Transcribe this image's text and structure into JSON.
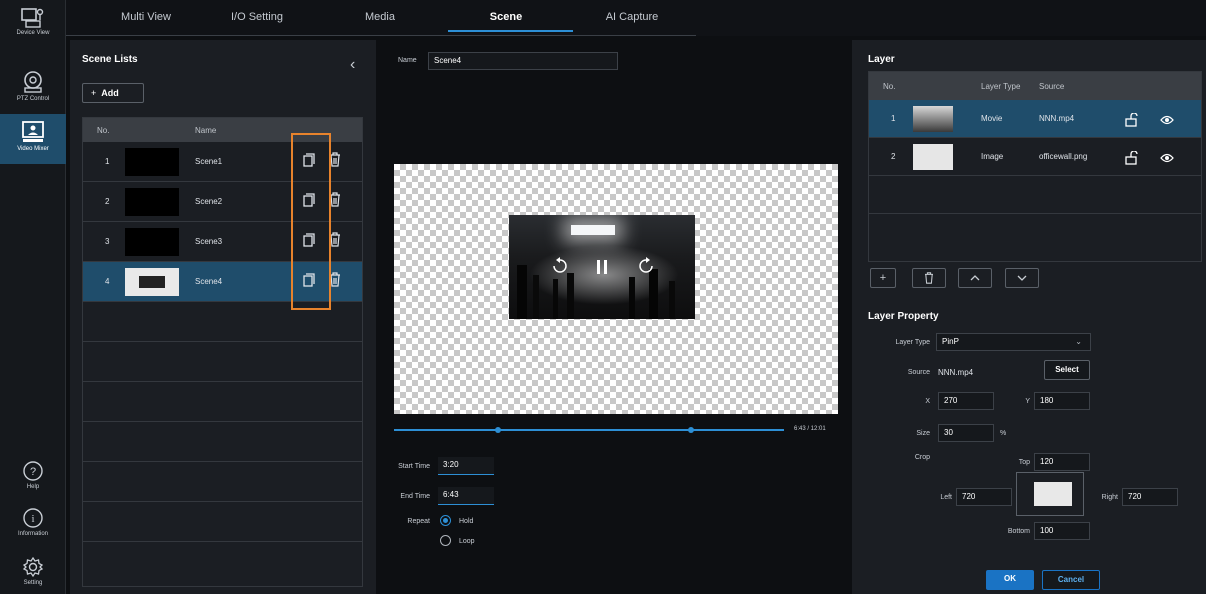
{
  "rail": {
    "items": [
      {
        "label": "Device View",
        "icon": "device-view-icon"
      },
      {
        "label": "PTZ Control",
        "icon": "ptz-camera-icon"
      },
      {
        "label": "Video Mixer",
        "icon": "video-mixer-icon"
      },
      {
        "label": "Help",
        "icon": "help-icon"
      },
      {
        "label": "Information",
        "icon": "info-icon"
      },
      {
        "label": "Setting",
        "icon": "gear-icon"
      }
    ]
  },
  "tabs": [
    "Multi View",
    "I/O Setting",
    "Media",
    "Scene",
    "AI Capture"
  ],
  "active_tab": "Scene",
  "scene_list": {
    "title": "Scene Lists",
    "add_label": "Add",
    "head_no": "No.",
    "head_name": "Name",
    "rows": [
      {
        "no": "1",
        "name": "Scene1"
      },
      {
        "no": "2",
        "name": "Scene2"
      },
      {
        "no": "3",
        "name": "Scene3"
      },
      {
        "no": "4",
        "name": "Scene4"
      }
    ],
    "selected": "4"
  },
  "editor": {
    "name_label": "Name",
    "name_value": "Scene4",
    "time_readout": "6:43 / 12:01",
    "start_label": "Start Time",
    "start_value": "3:20",
    "end_label": "End Time",
    "end_value": "6:43",
    "repeat_label": "Repeat",
    "repeat_options": [
      "Hold",
      "Loop"
    ],
    "repeat_selected": "Hold"
  },
  "layer": {
    "title": "Layer",
    "head_no": "No.",
    "head_type": "Layer Type",
    "head_source": "Source",
    "rows": [
      {
        "no": "1",
        "type": "Movie",
        "source": "NNN.mp4"
      },
      {
        "no": "2",
        "type": "Image",
        "source": "officewall.png"
      }
    ]
  },
  "property": {
    "title": "Layer Property",
    "layer_type_label": "Layer Type",
    "layer_type_value": "PinP",
    "source_label": "Source",
    "source_value": "NNN.mp4",
    "select_label": "Select",
    "x_label": "X",
    "x_value": "270",
    "y_label": "Y",
    "y_value": "180",
    "size_label": "Size",
    "size_value": "30",
    "size_unit": "%",
    "crop_label": "Crop",
    "top_label": "Top",
    "top_value": "120",
    "left_label": "Left",
    "left_value": "720",
    "right_label": "Right",
    "right_value": "720",
    "bottom_label": "Bottom",
    "bottom_value": "100",
    "ok_label": "OK",
    "cancel_label": "Cancel"
  },
  "colors": {
    "accent": "#2d8fd5",
    "selected_row": "#1f4d6b",
    "highlight_box": "#e8832c"
  }
}
